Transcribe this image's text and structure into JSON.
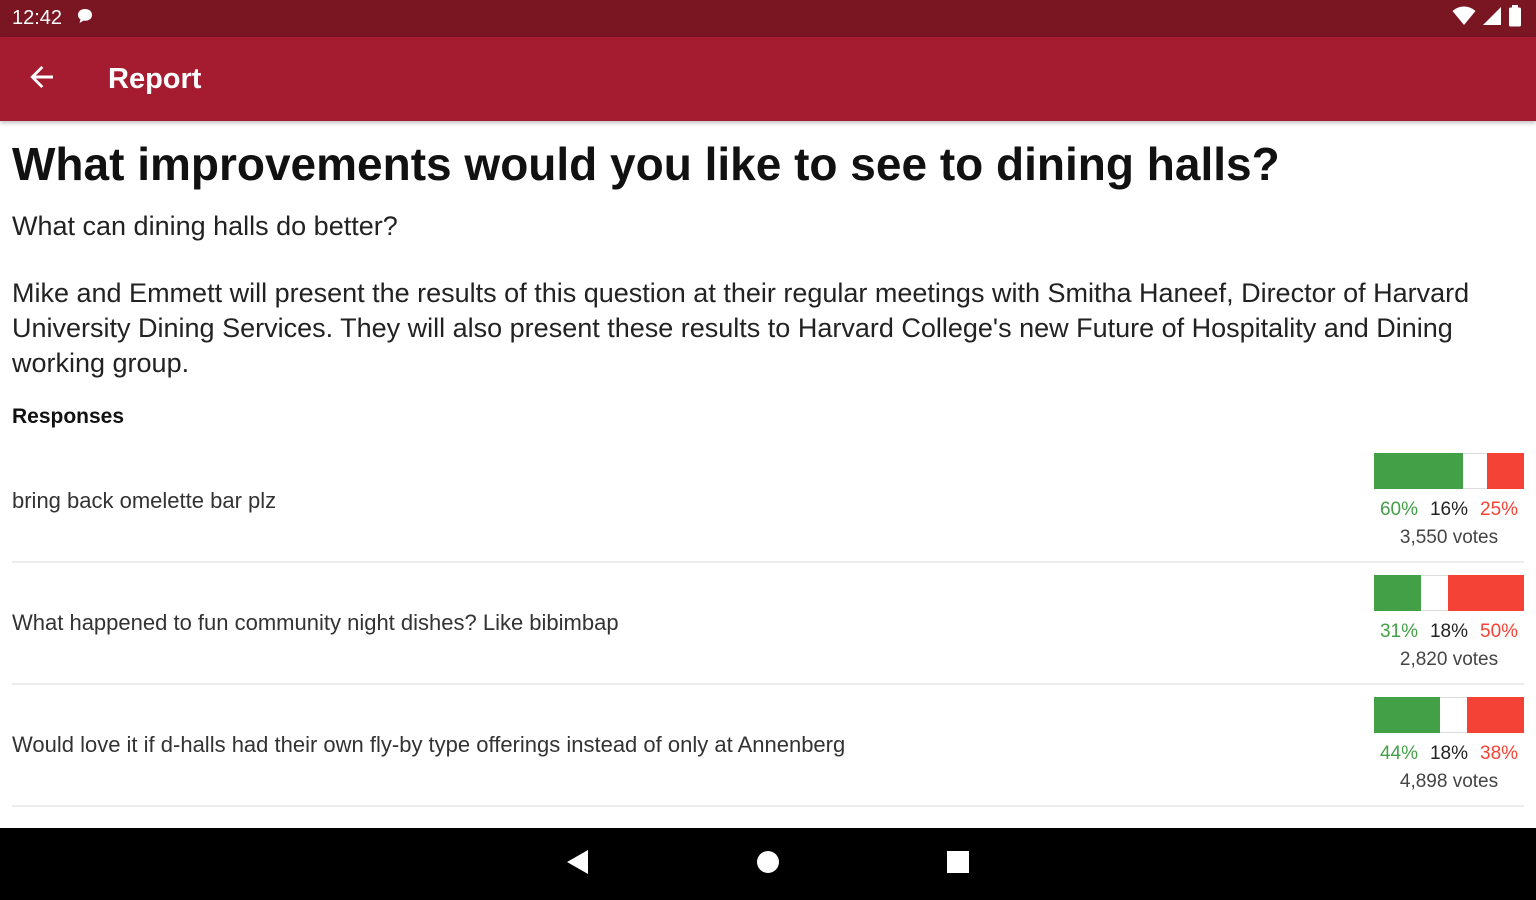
{
  "status_bar": {
    "time": "12:42",
    "icons": [
      "chat-bubble-icon",
      "wifi-icon",
      "signal-icon",
      "battery-icon"
    ]
  },
  "app_bar": {
    "title": "Report",
    "back_icon": "arrow-back-icon",
    "color": "#a51c30"
  },
  "question": {
    "title": "What improvements would you like to see to dining halls?",
    "subtitle": "What can dining halls do better?",
    "description": "Mike and Emmett will present the results of this question at their regular meetings with Smitha Haneef, Director of Harvard University Dining Services. They will also present these results to Harvard College's new Future of Hospitality and Dining working group."
  },
  "responses": {
    "heading": "Responses",
    "items": [
      {
        "text": "bring back omelette bar plz",
        "agree": "60%",
        "pass": "16%",
        "disagree": "25%",
        "agree_value": 60,
        "pass_value": 16,
        "disagree_value": 25,
        "votes": "3,550 votes"
      },
      {
        "text": "What happened to fun community night dishes? Like bibimbap",
        "agree": "31%",
        "pass": "18%",
        "disagree": "50%",
        "agree_value": 31,
        "pass_value": 18,
        "disagree_value": 50,
        "votes": "2,820 votes"
      },
      {
        "text": "Would love it if d-halls had their own fly-by type offerings instead of only at Annenberg",
        "agree": "44%",
        "pass": "18%",
        "disagree": "38%",
        "agree_value": 44,
        "pass_value": 18,
        "disagree_value": 38,
        "votes": "4,898 votes"
      }
    ]
  },
  "colors": {
    "agree": "#43a047",
    "disagree": "#f44336",
    "status_bar": "#7a1522"
  },
  "nav_bar": {
    "icons": [
      "back-triangle-icon",
      "home-circle-icon",
      "recents-square-icon"
    ]
  }
}
